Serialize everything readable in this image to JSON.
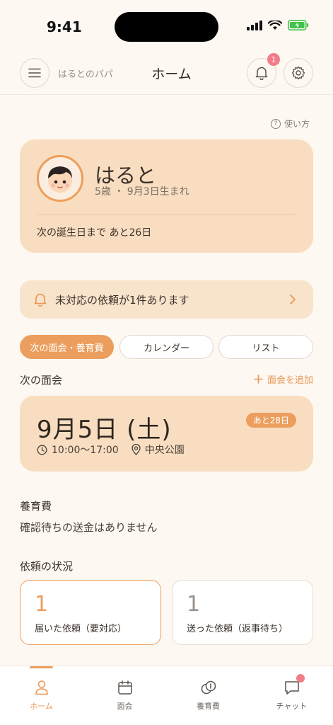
{
  "status_bar": {
    "time": "9:41"
  },
  "header": {
    "user_name": "はるとのパパ",
    "title": "ホーム",
    "notification_count": "1"
  },
  "help": {
    "label": "使い方"
  },
  "child": {
    "name": "はると",
    "meta": "5歳 ・ 9月3日生まれ",
    "birthday_countdown": "次の誕生日まで あと26日"
  },
  "alert": {
    "text": "未対応の依頼が1件あります"
  },
  "tabs": [
    {
      "label": "次の面会・養育費",
      "active": true
    },
    {
      "label": "カレンダー",
      "active": false
    },
    {
      "label": "リスト",
      "active": false
    }
  ],
  "next_meeting": {
    "section_title": "次の面会",
    "add_label": "面会を追加",
    "date": "9月5日 (土)",
    "countdown": "あと28日",
    "time": "10:00〜17:00",
    "place": "中央公園"
  },
  "child_support": {
    "section_title": "養育費",
    "status": "確認待ちの送金はありません"
  },
  "requests": {
    "section_title": "依頼の状況",
    "received": {
      "count": "1",
      "label": "届いた依頼（要対応）"
    },
    "sent": {
      "count": "1",
      "label": "送った依頼（返事待ち）"
    }
  },
  "bottom_nav": [
    {
      "label": "ホーム",
      "icon": "person-icon",
      "active": true
    },
    {
      "label": "面会",
      "icon": "calendar-icon",
      "active": false
    },
    {
      "label": "養育費",
      "icon": "coins-icon",
      "active": false
    },
    {
      "label": "チャット",
      "icon": "chat-icon",
      "active": false
    }
  ],
  "colors": {
    "accent": "#EC9E5E",
    "card": "#F8DDC0",
    "background": "#FDF8F2",
    "badge": "#F07D88"
  }
}
